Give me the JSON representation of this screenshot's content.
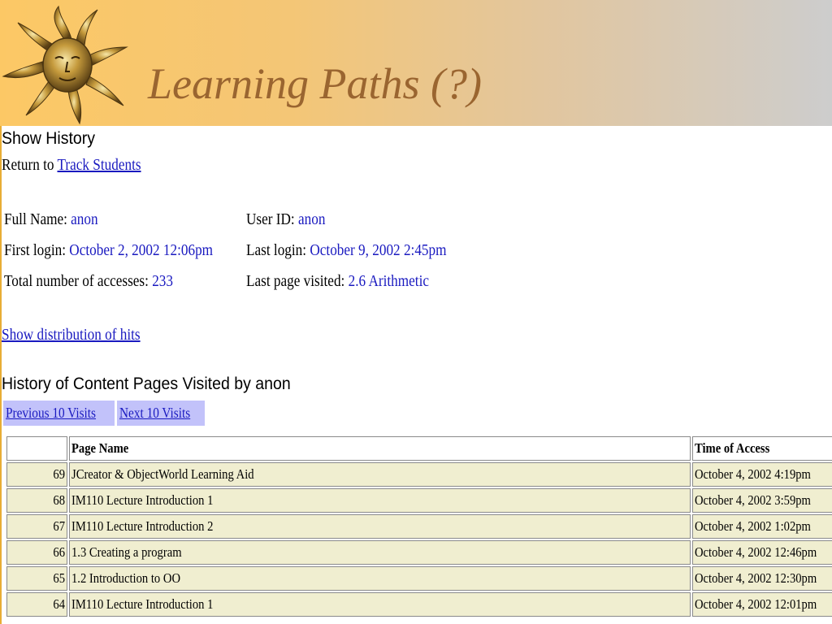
{
  "slide": {
    "title": "Learning Paths (?)"
  },
  "history": {
    "heading": "Show History",
    "return_prefix": "Return to ",
    "return_link": "Track Students",
    "fields": {
      "full_name_label": "Full Name: ",
      "full_name_value": "anon",
      "user_id_label": "User ID: ",
      "user_id_value": "anon",
      "first_login_label": "First login: ",
      "first_login_value": "October 2, 2002 12:06pm",
      "last_login_label": "Last login: ",
      "last_login_value": "October 9, 2002 2:45pm",
      "total_accesses_label": "Total number of accesses: ",
      "total_accesses_value": "233",
      "last_page_label": "Last page visited: ",
      "last_page_value": "2.6 Arithmetic"
    },
    "distribution_link": "Show distribution of hits",
    "content_heading": "History of Content Pages Visited by anon",
    "prev_button": "Previous 10 Visits",
    "next_button": "Next 10 Visits",
    "table": {
      "columns": [
        "",
        "Page Name",
        "Time of Access"
      ],
      "rows": [
        {
          "num": "69",
          "page": "JCreator & ObjectWorld Learning Aid",
          "time": "October 4, 2002 4:19pm"
        },
        {
          "num": "68",
          "page": "IM110 Lecture Introduction 1",
          "time": "October 4, 2002 3:59pm"
        },
        {
          "num": "67",
          "page": "IM110 Lecture Introduction 2",
          "time": "October 4, 2002 1:02pm"
        },
        {
          "num": "66",
          "page": "1.3 Creating a program",
          "time": "October 4, 2002 12:46pm"
        },
        {
          "num": "65",
          "page": "1.2 Introduction to OO",
          "time": "October 4, 2002 12:30pm"
        },
        {
          "num": "64",
          "page": "IM110 Lecture Introduction 1",
          "time": "October 4, 2002 12:01pm"
        }
      ]
    }
  },
  "colors": {
    "banner_start": "#fcc865",
    "banner_end": "#cdcdcd",
    "title": "#9a6530",
    "link": "#1a1ac0",
    "tab_bg": "#c2c2fa",
    "row_bg": "#f0eed0"
  },
  "icons": {
    "logo": "sun-face-icon"
  }
}
